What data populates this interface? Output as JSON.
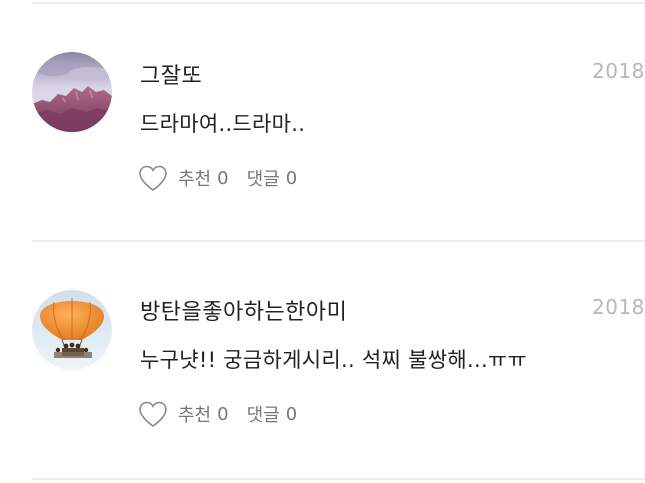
{
  "comments": [
    {
      "author": "그잘또",
      "date": "2018.0",
      "text": "드라마여..드라마..",
      "like_label": "추천",
      "like_count": "0",
      "reply_label": "댓글",
      "reply_count": "0",
      "avatar_icon": "mountain-landscape-avatar"
    },
    {
      "author": "방탄을좋아하는한아미",
      "date": "2018.0",
      "text": "누구냣!! 궁금하게시리.. 석찌 불쌍해...ㅠㅠ",
      "like_label": "추천",
      "like_count": "0",
      "reply_label": "댓글",
      "reply_count": "0",
      "avatar_icon": "hot-air-balloon-avatar"
    }
  ],
  "colors": {
    "divider": "#e7efe9",
    "date": "#b3bab6",
    "action_text": "#777777",
    "body_text": "#222222"
  }
}
